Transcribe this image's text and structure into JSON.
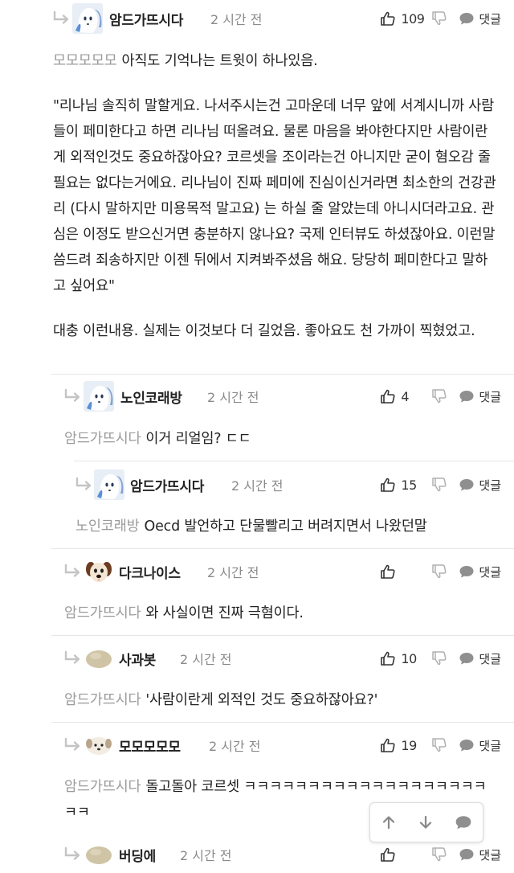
{
  "ui": {
    "reply_label": "댓글"
  },
  "comments": [
    {
      "nick": "암드가뜨시다",
      "time": "2 시간 전",
      "likes": "109",
      "mention": "모모모모모",
      "paragraphs": [
        "아직도 기억나는 트윗이 하나있음.",
        "\"리나님 솔직히 말할게요. 나서주시는건 고마운데 너무 앞에 서계시니까 사람들이 페미한다고 하면 리나님 떠올려요. 물론 마음을 봐야한다지만 사람이란게 외적인것도 중요하잖아요? 코르셋을 조이라는건 아니지만 굳이 혐오감 줄 필요는 없다는거에요. 리나님이 진짜 페미에 진심이신거라면 최소한의 건강관리 (다시 말하지만 미용목적 말고요) 는 하실 줄 알았는데 아니시더라고요. 관심은 이정도 받으신거면 충분하지 않나요? 국제 인터뷰도 하셨잖아요. 이런말씀드려 죄송하지만 이젠 뒤에서 지켜봐주셨음 해요. 당당히 페미한다고 말하고 싶어요\"",
        "대충 이런내용. 실제는 이것보다 더 길었음. 좋아요도 천 가까이 찍혔었고."
      ]
    },
    {
      "nick": "노인코래방",
      "time": "2 시간 전",
      "likes": "4",
      "mention": "암드가뜨시다",
      "text": "이거 리얼임? ㄷㄷ"
    },
    {
      "nick": "암드가뜨시다",
      "time": "2 시간 전",
      "likes": "15",
      "mention": "노인코래방",
      "text": "Oecd 발언하고 단물빨리고 버려지면서 나왔던말"
    },
    {
      "nick": "다크나이스",
      "time": "2 시간 전",
      "likes": "",
      "mention": "암드가뜨시다",
      "text": "와 사실이면 진짜 극혐이다."
    },
    {
      "nick": "사과봇",
      "time": "2 시간 전",
      "likes": "10",
      "mention": "암드가뜨시다",
      "text": "'사람이란게 외적인 것도 중요하잖아요?'"
    },
    {
      "nick": "모모모모모",
      "time": "2 시간 전",
      "likes": "19",
      "mention": "암드가뜨시다",
      "text": "돌고돌아 코르셋 ㅋㅋㅋㅋㅋㅋㅋㅋㅋㅋㅋㅋㅋㅋㅋㅋㅋㅋㅋㅋㅋ"
    },
    {
      "nick": "버딩에",
      "time": "2 시간 전",
      "likes": ""
    }
  ],
  "icons": {
    "reply_arrow": "reply-arrow-icon",
    "thumb_up": "thumbs-up-icon",
    "thumb_down": "thumbs-down-icon",
    "speech": "speech-bubble-icon",
    "up": "arrow-up-icon",
    "down": "arrow-down-icon"
  }
}
